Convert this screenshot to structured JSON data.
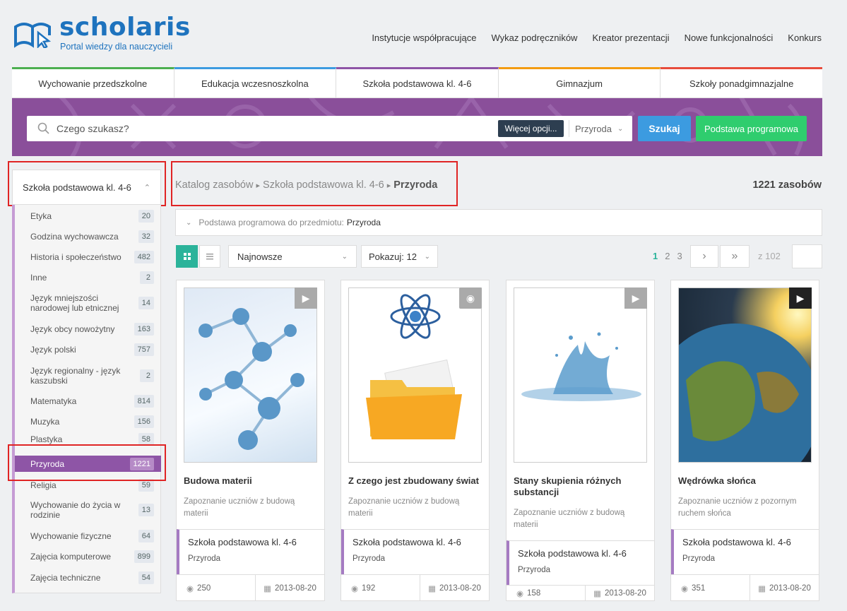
{
  "brand": {
    "title": "scholaris",
    "subtitle": "Portal wiedzy dla nauczycieli"
  },
  "topnav": [
    "Instytucje współpracujące",
    "Wykaz podręczników",
    "Kreator prezentacji",
    "Nowe funkcjonalności",
    "Konkurs"
  ],
  "level_tabs": [
    {
      "label": "Wychowanie przedszkolne",
      "color": "#4caf50"
    },
    {
      "label": "Edukacja wczesnoszkolna",
      "color": "#3c9be0"
    },
    {
      "label": "Szkoła podstawowa kl. 4-6",
      "color": "#8e55a6"
    },
    {
      "label": "Gimnazjum",
      "color": "#f39c12"
    },
    {
      "label": "Szkoły ponadgimnazjalne",
      "color": "#e74c3c"
    }
  ],
  "search": {
    "placeholder": "Czego szukasz?",
    "more_options": "Więcej opcji...",
    "subject": "Przyroda",
    "search_button": "Szukaj",
    "curriculum_button": "Podstawa programowa"
  },
  "sidebar": {
    "header": "Szkoła podstawowa kl. 4-6",
    "items": [
      {
        "label": "Etyka",
        "count": "20"
      },
      {
        "label": "Godzina wychowawcza",
        "count": "32"
      },
      {
        "label": "Historia i społeczeństwo",
        "count": "482"
      },
      {
        "label": "Inne",
        "count": "2"
      },
      {
        "label": "Język mniejszości narodowej lub etnicznej",
        "count": "14"
      },
      {
        "label": "Język obcy nowożytny",
        "count": "163"
      },
      {
        "label": "Język polski",
        "count": "757"
      },
      {
        "label": "Język regionalny - język kaszubski",
        "count": "2"
      },
      {
        "label": "Matematyka",
        "count": "814"
      },
      {
        "label": "Muzyka",
        "count": "156"
      },
      {
        "label": "Plastyka",
        "count": "58"
      },
      {
        "label": "Przyroda",
        "count": "1221",
        "active": true
      },
      {
        "label": "Religia",
        "count": "59"
      },
      {
        "label": "Wychowanie do życia w rodzinie",
        "count": "13"
      },
      {
        "label": "Wychowanie fizyczne",
        "count": "64"
      },
      {
        "label": "Zajęcia komputerowe",
        "count": "899"
      },
      {
        "label": "Zajęcia techniczne",
        "count": "54"
      }
    ]
  },
  "breadcrumb": {
    "part1": "Katalog zasobów",
    "sep": "▸",
    "part2": "Szkoła podstawowa kl. 4-6",
    "current": "Przyroda"
  },
  "result_count": "1221 zasobów",
  "curriculum_bar": {
    "label": "Podstawa programowa do przedmiotu:",
    "value": "Przyroda"
  },
  "toolbar": {
    "sort": "Najnowsze",
    "show": "Pokazuj: 12"
  },
  "pagination": {
    "pages": [
      "1",
      "2",
      "3"
    ],
    "current": "1",
    "next": "›",
    "last": "»",
    "of_label": "z 102"
  },
  "cards": [
    {
      "title": "Budowa materii",
      "desc": "Zapoznanie uczniów z budową materii",
      "level": "Szkoła podstawowa kl. 4-6",
      "subject": "Przyroda",
      "views": "250",
      "date": "2013-08-20",
      "type_icon": "video-icon"
    },
    {
      "title": "Z czego jest zbudowany świat",
      "desc": "Zapoznanie uczniów z budową materii",
      "level": "Szkoła podstawowa kl. 4-6",
      "subject": "Przyroda",
      "views": "192",
      "date": "2013-08-20",
      "type_icon": "bell-icon"
    },
    {
      "title": "Stany skupienia różnych substancji",
      "desc": "Zapoznanie uczniów z budową materii",
      "level": "Szkoła podstawowa kl. 4-6",
      "subject": "Przyroda",
      "views": "158",
      "date": "2013-08-20",
      "type_icon": "video-icon"
    },
    {
      "title": "Wędrówka słońca",
      "desc": "Zapoznanie uczniów z pozornym ruchem słońca",
      "level": "Szkoła podstawowa kl. 4-6",
      "subject": "Przyroda",
      "views": "351",
      "date": "2013-08-20",
      "type_icon": "video-icon"
    }
  ]
}
